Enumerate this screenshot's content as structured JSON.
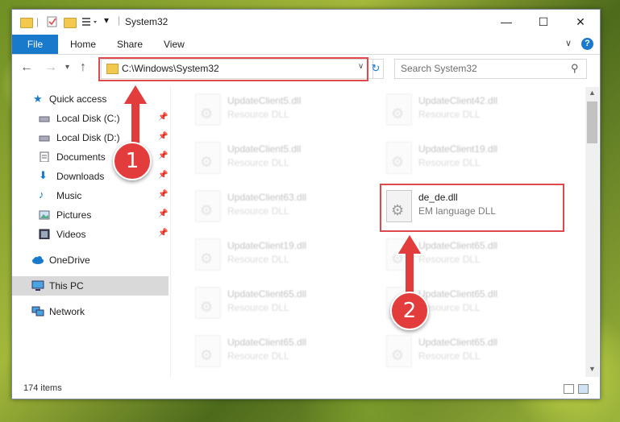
{
  "window": {
    "title": "System32",
    "controls": {
      "minimize": "—",
      "maximize": "☐",
      "close": "✕"
    }
  },
  "ribbon": {
    "tabs": [
      "File",
      "Home",
      "Share",
      "View"
    ],
    "help_label": "?"
  },
  "navigation": {
    "address": "C:\\Windows\\System32",
    "search_placeholder": "Search System32"
  },
  "sidebar": {
    "quick_access": "Quick access",
    "items": [
      {
        "label": "Local Disk (C:)",
        "icon": "drive-icon",
        "pinned": true
      },
      {
        "label": "Local Disk (D:)",
        "icon": "drive-icon",
        "pinned": true
      },
      {
        "label": "Documents",
        "icon": "documents-icon",
        "pinned": true
      },
      {
        "label": "Downloads",
        "icon": "download-icon",
        "pinned": true
      },
      {
        "label": "Music",
        "icon": "music-icon",
        "pinned": true
      },
      {
        "label": "Pictures",
        "icon": "pictures-icon",
        "pinned": true
      },
      {
        "label": "Videos",
        "icon": "videos-icon",
        "pinned": true
      }
    ],
    "onedrive": "OneDrive",
    "this_pc": "This PC",
    "network": "Network"
  },
  "files": [
    {
      "name": "UpdateClient5.dll",
      "desc": "Resource DLL",
      "highlighted": false
    },
    {
      "name": "UpdateClient42.dll",
      "desc": "Resource DLL",
      "highlighted": false
    },
    {
      "name": "UpdateClient5.dll",
      "desc": "Resource DLL",
      "highlighted": false
    },
    {
      "name": "UpdateClient19.dll",
      "desc": "Resource DLL",
      "highlighted": false
    },
    {
      "name": "UpdateClient63.dll",
      "desc": "Resource DLL",
      "highlighted": false
    },
    {
      "name": "de_de.dll",
      "desc": "EM language DLL",
      "highlighted": true
    },
    {
      "name": "UpdateClient19.dll",
      "desc": "Resource DLL",
      "highlighted": false
    },
    {
      "name": "UpdateClient65.dll",
      "desc": "Resource DLL",
      "highlighted": false
    },
    {
      "name": "UpdateClient65.dll",
      "desc": "Resource DLL",
      "highlighted": false
    },
    {
      "name": "UpdateClient65.dll",
      "desc": "Resource DLL",
      "highlighted": false
    },
    {
      "name": "UpdateClient65.dll",
      "desc": "Resource DLL",
      "highlighted": false
    },
    {
      "name": "UpdateClient65.dll",
      "desc": "Resource DLL",
      "highlighted": false
    }
  ],
  "status": {
    "item_count": "174 items"
  },
  "annotations": {
    "step1": "1",
    "step2": "2",
    "accent_color": "#e0494c"
  },
  "colors": {
    "file_tab": "#1979ca",
    "selected_row": "#d9d9d9"
  }
}
